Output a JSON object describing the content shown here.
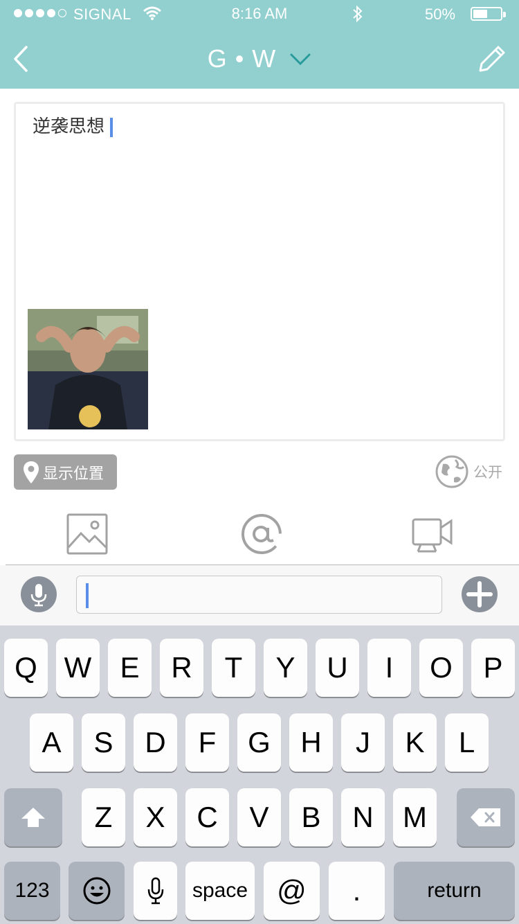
{
  "status_bar": {
    "carrier": "SIGNAL",
    "time": "8:16 AM",
    "battery": "50%",
    "battery_level": 0.5,
    "signal_bars": 4
  },
  "nav": {
    "title": "G • W"
  },
  "compose": {
    "text": "逆袭思想"
  },
  "location_button": {
    "label": "显示位置"
  },
  "privacy": {
    "label": "公开"
  },
  "input_bar": {
    "value": "",
    "placeholder": ""
  },
  "keyboard": {
    "row1": [
      "Q",
      "W",
      "E",
      "R",
      "T",
      "Y",
      "U",
      "I",
      "O",
      "P"
    ],
    "row2": [
      "A",
      "S",
      "D",
      "F",
      "G",
      "H",
      "J",
      "K",
      "L"
    ],
    "row3": [
      "Z",
      "X",
      "C",
      "V",
      "B",
      "N",
      "M"
    ],
    "numbers": "123",
    "space": "space",
    "at": "@",
    "dot": ".",
    "return": "return"
  },
  "colors": {
    "header": "#92cfcf",
    "caret": "#5b8ee8",
    "keyboard_bg": "#d2d5db",
    "key_dark": "#acb3bd"
  }
}
